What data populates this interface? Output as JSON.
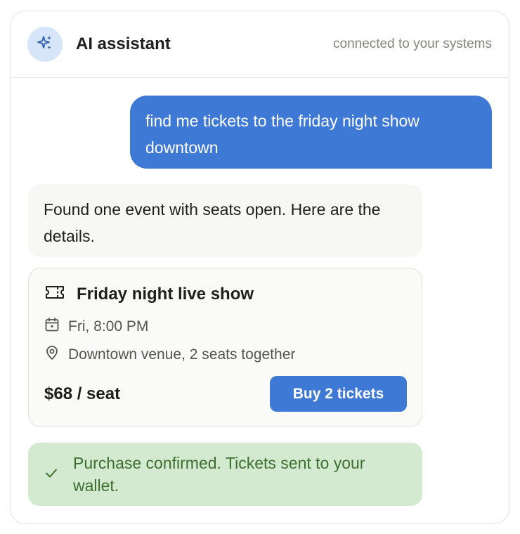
{
  "header": {
    "avatar_icon": "sparkles-icon",
    "title": "AI assistant",
    "subtitle": "connected to your systems"
  },
  "conversation": {
    "user_message": "find me tickets to the friday night show downtown",
    "assistant_message": "Found one event with seats open. Here are the details."
  },
  "event": {
    "icon": "ticket-icon",
    "title": "Friday night live show",
    "datetime": "Fri, 8:00 PM",
    "datetime_icon": "calendar-icon",
    "location": "Downtown venue, 2 seats together",
    "location_icon": "location-pin-icon",
    "price": "$68 / seat",
    "buy_label": "Buy 2 tickets"
  },
  "confirmation": {
    "icon": "check-icon",
    "text": "Purchase confirmed. Tickets sent to your wallet."
  },
  "colors": {
    "accent": "#3f79d6",
    "avatar_bg": "#d6e5f8",
    "success_bg": "#d3ead0",
    "success_text": "#3d6e2f"
  }
}
